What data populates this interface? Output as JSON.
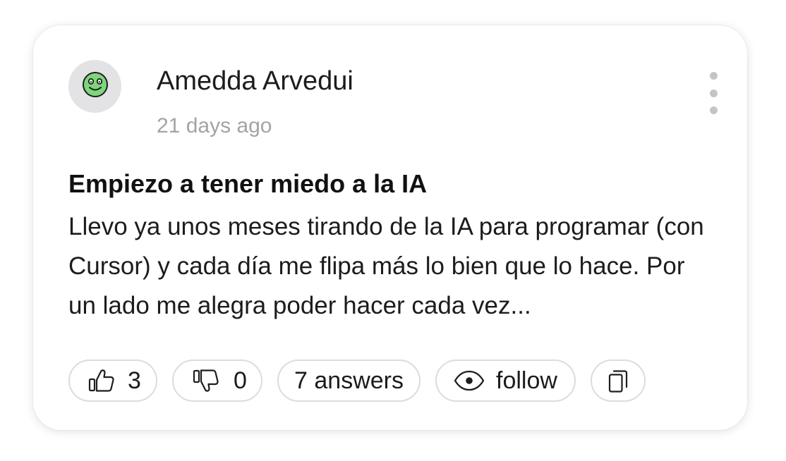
{
  "post": {
    "author": "Amedda Arvedui",
    "time": "21 days ago",
    "title": "Empiezo a tener miedo a la IA",
    "body": "Llevo ya unos meses tirando de la IA para programar (con Cursor) y cada día me flipa más lo bien que lo hace. Por un lado me alegra poder hacer cada vez..."
  },
  "avatar": {
    "icon": "smiley-face-icon",
    "face_color": "#7ed67a",
    "background_color": "#e3e3e6"
  },
  "menu": {
    "icon": "more-vertical-icon"
  },
  "actions": {
    "likes": "3",
    "dislikes": "0",
    "answers_label": "7 answers",
    "follow_label": "follow",
    "like_icon": "thumbs-up-icon",
    "dislike_icon": "thumbs-down-icon",
    "follow_icon": "eye-icon",
    "copy_icon": "copy-icon"
  }
}
